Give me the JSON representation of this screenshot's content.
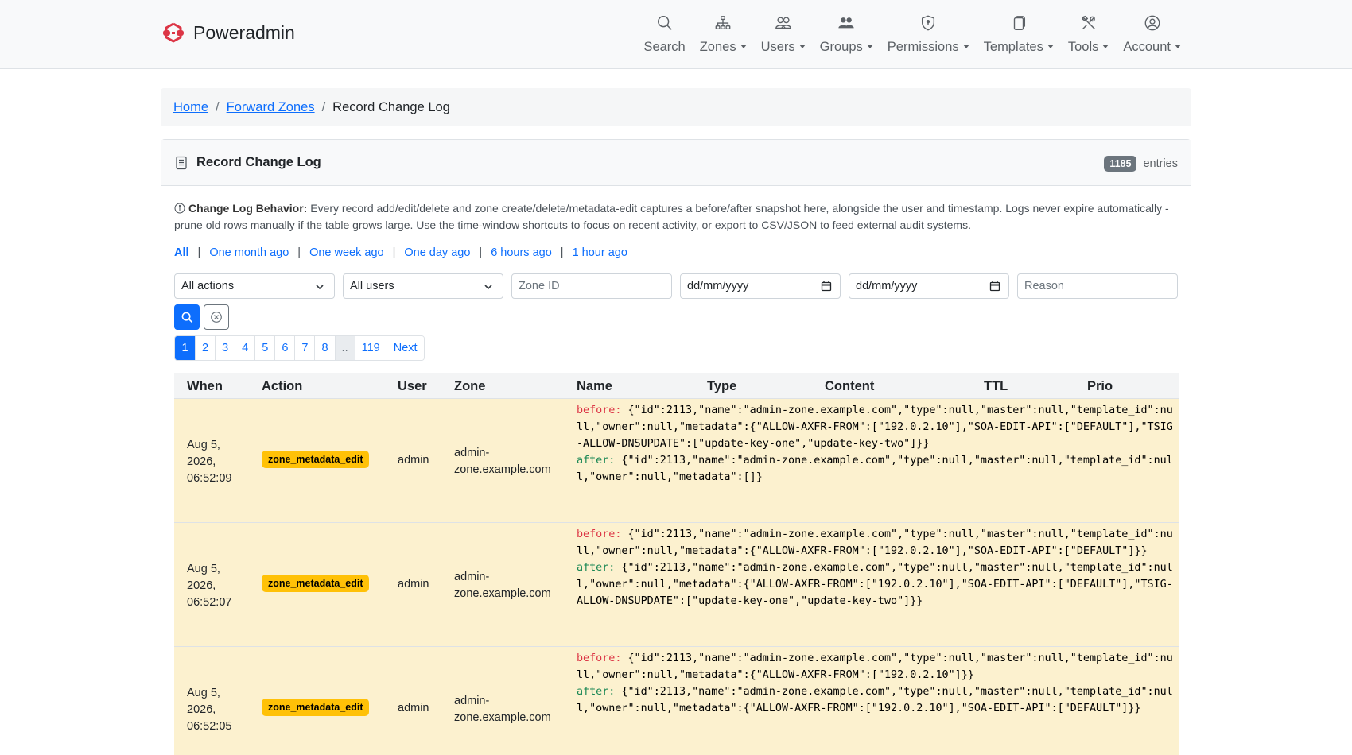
{
  "app": {
    "name": "Poweradmin"
  },
  "nav": [
    {
      "key": "search",
      "label": "Search",
      "icon": "search-icon",
      "dropdown": false
    },
    {
      "key": "zones",
      "label": "Zones",
      "icon": "zones-icon",
      "dropdown": true
    },
    {
      "key": "users",
      "label": "Users",
      "icon": "users-icon",
      "dropdown": true
    },
    {
      "key": "groups",
      "label": "Groups",
      "icon": "groups-icon",
      "dropdown": true
    },
    {
      "key": "permissions",
      "label": "Permissions",
      "icon": "shield-icon",
      "dropdown": true
    },
    {
      "key": "templates",
      "label": "Templates",
      "icon": "templates-icon",
      "dropdown": true
    },
    {
      "key": "tools",
      "label": "Tools",
      "icon": "tools-icon",
      "dropdown": true
    },
    {
      "key": "account",
      "label": "Account",
      "icon": "account-icon",
      "dropdown": true
    }
  ],
  "breadcrumb": {
    "home": "Home",
    "forward_zones": "Forward Zones",
    "current": "Record Change Log",
    "separator": "/"
  },
  "card": {
    "title": "Record Change Log",
    "entries_count": "1185",
    "entries_label": "entries",
    "info_title": "Change Log Behavior:",
    "info_text": " Every record add/edit/delete and zone create/delete/metadata-edit captures a before/after snapshot here, alongside the user and timestamp. Logs never expire automatically - prune old rows manually if the table grows large. Use the time-window shortcuts to focus on recent activity, or export to CSV/JSON to feed external audit systems."
  },
  "time_links": [
    "All",
    "One month ago",
    "One week ago",
    "One day ago",
    "6 hours ago",
    "1 hour ago"
  ],
  "filters": {
    "action": "All actions",
    "user": "All users",
    "zone_placeholder": "Zone ID",
    "date_from": "dd/mm/yyyy",
    "date_to": "dd/mm/yyyy",
    "reason_placeholder": "Reason"
  },
  "pagination": {
    "pages": [
      "1",
      "2",
      "3",
      "4",
      "5",
      "6",
      "7",
      "8"
    ],
    "dots": "..",
    "last": "119",
    "next": "Next"
  },
  "table": {
    "headers": {
      "when": "When",
      "action": "Action",
      "user": "User",
      "zone": "Zone",
      "name": "Name",
      "type": "Type",
      "content": "Content",
      "ttl": "TTL",
      "prio": "Prio"
    },
    "label_before": "before:",
    "label_after": "after:",
    "rows": [
      {
        "when": "Aug 5, 2026, 06:52:09",
        "action": "zone_metadata_edit",
        "user": "admin",
        "zone": "admin-zone.example.com",
        "before": "{\"id\":2113,\"name\":\"admin-zone.example.com\",\"type\":null,\"master\":null,\"template_id\":null,\"owner\":null,\"metadata\":{\"ALLOW-AXFR-FROM\":[\"192.0.2.10\"],\"SOA-EDIT-API\":[\"DEFAULT\"],\"TSIG-ALLOW-DNSUPDATE\":[\"update-key-one\",\"update-key-two\"]}}",
        "after": "{\"id\":2113,\"name\":\"admin-zone.example.com\",\"type\":null,\"master\":null,\"template_id\":null,\"owner\":null,\"metadata\":[]}"
      },
      {
        "when": "Aug 5, 2026, 06:52:07",
        "action": "zone_metadata_edit",
        "user": "admin",
        "zone": "admin-zone.example.com",
        "before": "{\"id\":2113,\"name\":\"admin-zone.example.com\",\"type\":null,\"master\":null,\"template_id\":null,\"owner\":null,\"metadata\":{\"ALLOW-AXFR-FROM\":[\"192.0.2.10\"],\"SOA-EDIT-API\":[\"DEFAULT\"]}}",
        "after": "{\"id\":2113,\"name\":\"admin-zone.example.com\",\"type\":null,\"master\":null,\"template_id\":null,\"owner\":null,\"metadata\":{\"ALLOW-AXFR-FROM\":[\"192.0.2.10\"],\"SOA-EDIT-API\":[\"DEFAULT\"],\"TSIG-ALLOW-DNSUPDATE\":[\"update-key-one\",\"update-key-two\"]}}"
      },
      {
        "when": "Aug 5, 2026, 06:52:05",
        "action": "zone_metadata_edit",
        "user": "admin",
        "zone": "admin-zone.example.com",
        "before": "{\"id\":2113,\"name\":\"admin-zone.example.com\",\"type\":null,\"master\":null,\"template_id\":null,\"owner\":null,\"metadata\":{\"ALLOW-AXFR-FROM\":[\"192.0.2.10\"]}}",
        "after": "{\"id\":2113,\"name\":\"admin-zone.example.com\",\"type\":null,\"master\":null,\"template_id\":null,\"owner\":null,\"metadata\":{\"ALLOW-AXFR-FROM\":[\"192.0.2.10\"],\"SOA-EDIT-API\":[\"DEFAULT\"]}}"
      }
    ]
  },
  "colors": {
    "primary": "#0d6efd",
    "warning": "#ffc107",
    "row_bg": "#fcf1cf",
    "brand_red": "#dc3545",
    "before": "#dc3545",
    "after": "#198754"
  }
}
